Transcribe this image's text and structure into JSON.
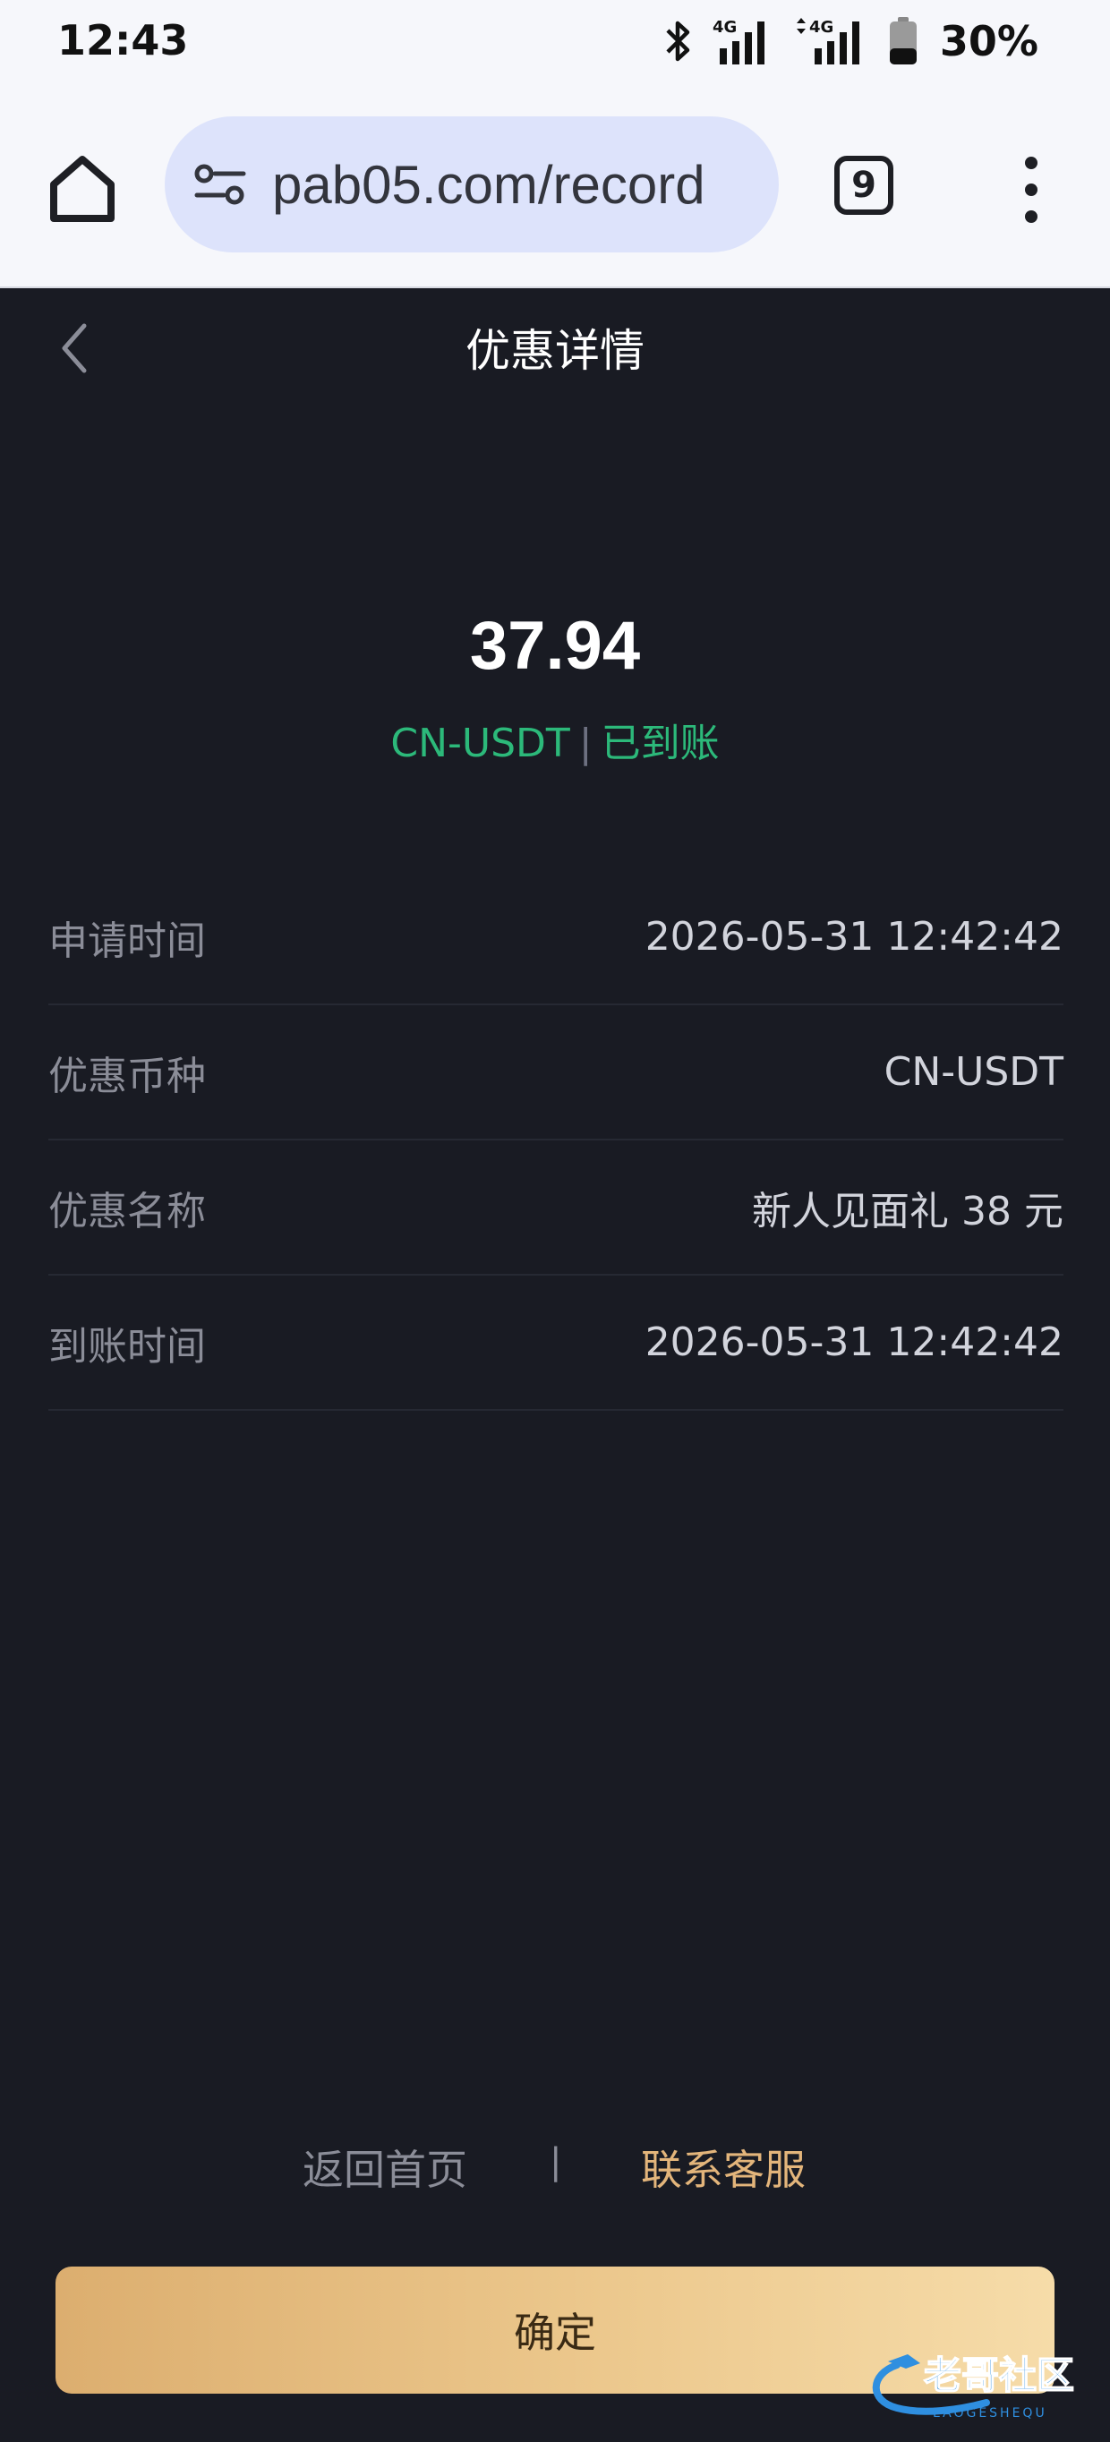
{
  "status_bar": {
    "time": "12:43",
    "battery": "30%",
    "network_1": "4G",
    "network_2": "4G",
    "icons": [
      "bluetooth-icon",
      "signal-icon",
      "signal-icon",
      "battery-icon"
    ]
  },
  "browser": {
    "url": "pab05.com/record",
    "tab_count": "9",
    "icons": [
      "home-icon",
      "tune-icon",
      "tabs-icon",
      "more-vert-icon"
    ]
  },
  "header": {
    "title": "优惠详情"
  },
  "summary": {
    "amount": "37.94",
    "currency": "CN-USDT",
    "separator": "|",
    "status": "已到账"
  },
  "details": [
    {
      "label": "申请时间",
      "value": "2026-05-31 12:42:42"
    },
    {
      "label": "优惠币种",
      "value": "CN-USDT"
    },
    {
      "label": "优惠名称",
      "value": "新人见面礼 38 元"
    },
    {
      "label": "到账时间",
      "value": "2026-05-31 12:42:42"
    }
  ],
  "footer": {
    "back_home": "返回首页",
    "separator": "|",
    "contact_support": "联系客服",
    "confirm": "确定"
  },
  "watermark": {
    "text": "老哥社区",
    "subtext": "LAOGESHEQU"
  },
  "colors": {
    "background": "#191b23",
    "status_green": "#2cb97a",
    "accent_gold": "#e3b57b"
  }
}
